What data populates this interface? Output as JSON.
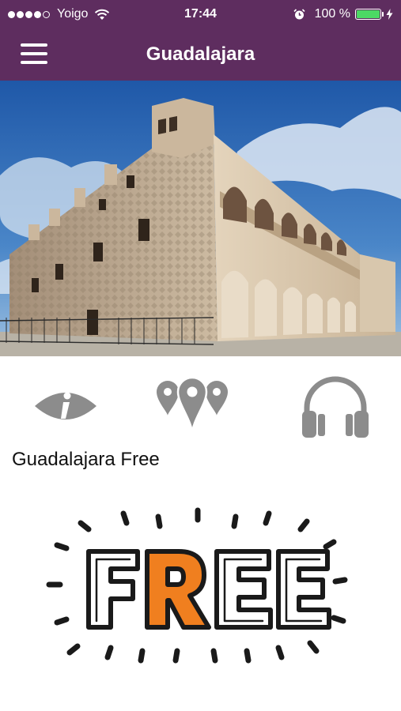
{
  "status_bar": {
    "carrier": "Yoigo",
    "time": "17:44",
    "battery_percent": "100 %",
    "battery_level": 1.0,
    "signal_bars_filled": 4,
    "signal_bars_total": 5
  },
  "nav_bar": {
    "title": "Guadalajara",
    "menu_icon": "hamburger-menu-icon"
  },
  "hero": {
    "image_description_icon": "palace-photo"
  },
  "actions": {
    "info_icon": "info-eye-icon",
    "map_icon": "map-pins-icon",
    "audio_icon": "headphones-icon"
  },
  "item": {
    "title": "Guadalajara Free"
  },
  "badge": {
    "letters": [
      "F",
      "R",
      "E",
      "E"
    ]
  },
  "colors": {
    "brand": "#5e2d5f",
    "icon_gray": "#8c8c8c",
    "battery_green": "#4cd964",
    "badge_accent": "#f07f1f"
  }
}
